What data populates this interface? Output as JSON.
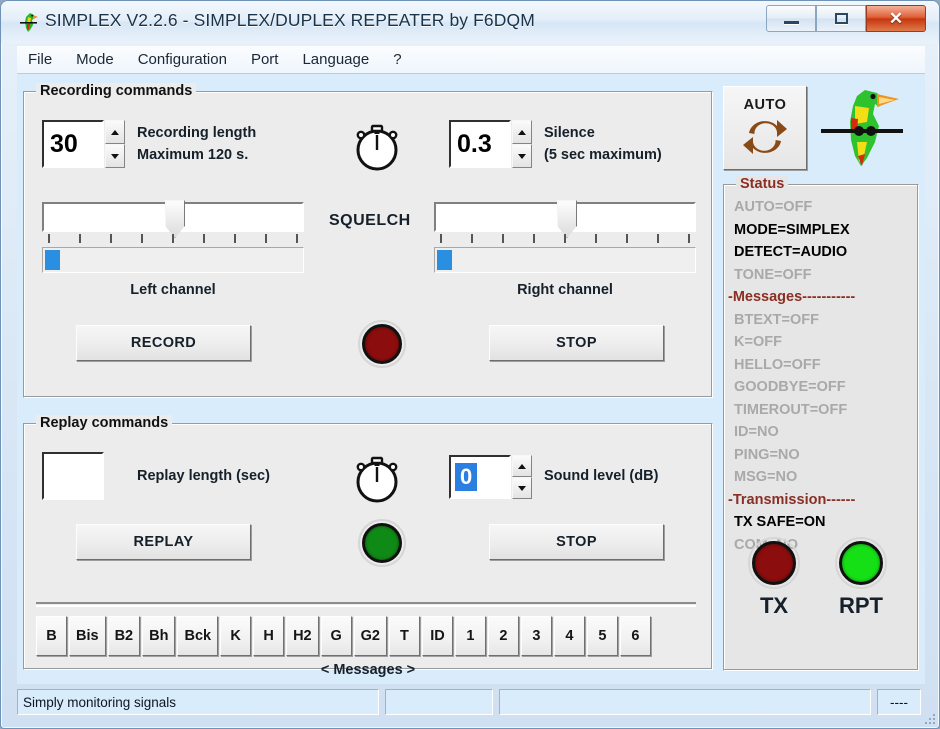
{
  "window": {
    "title": "SIMPLEX V2.2.6 - SIMPLEX/DUPLEX REPEATER by F6DQM",
    "icon": "parrot-icon",
    "minimize_label": "minimize-icon",
    "maximize_label": "maximize-icon",
    "close_label": "✕"
  },
  "menu": {
    "items": [
      {
        "label": "File"
      },
      {
        "label": "Mode"
      },
      {
        "label": "Configuration"
      },
      {
        "label": "Port"
      },
      {
        "label": "Language"
      },
      {
        "label": "?"
      }
    ]
  },
  "recording": {
    "group_title": "Recording commands",
    "length_value": "30",
    "length_label_line1": "Recording length",
    "length_label_line2": "Maximum 120 s.",
    "silence_value": "0.3",
    "silence_label_line1": "Silence",
    "silence_label_line2": "(5 sec maximum)",
    "squelch_label": "SQUELCH",
    "left_channel_label": "Left channel",
    "right_channel_label": "Right channel",
    "record_button": "RECORD",
    "stop_button": "STOP",
    "left_slider_percent": 50,
    "right_slider_percent": 50,
    "left_meter_percent": 6,
    "right_meter_percent": 6,
    "led_color": "#8c0d0d",
    "meter_color": "#2a8fe0"
  },
  "replay": {
    "group_title": "Replay commands",
    "length_value": "",
    "length_label": "Replay length (sec)",
    "sound_level_value": "0",
    "sound_level_label": "Sound level (dB)",
    "replay_button": "REPLAY",
    "stop_button": "STOP",
    "led_color": "#0f8a16",
    "messages_caption": "< Messages >",
    "message_buttons": [
      "B",
      "Bis",
      "B2",
      "Bh",
      "Bck",
      "K",
      "H",
      "H2",
      "G",
      "G2",
      "T",
      "ID",
      "1",
      "2",
      "3",
      "4",
      "5",
      "6"
    ]
  },
  "auto": {
    "label": "AUTO",
    "icon": "refresh-cycle-icon"
  },
  "status": {
    "group_title": "Status",
    "lines": [
      {
        "text": "AUTO=OFF",
        "state": "off"
      },
      {
        "text": "MODE=SIMPLEX",
        "state": "on"
      },
      {
        "text": "DETECT=AUDIO",
        "state": "on"
      },
      {
        "text": "TONE=OFF",
        "state": "off"
      },
      {
        "text": "-Messages-----------",
        "state": "header"
      },
      {
        "text": "BTEXT=OFF",
        "state": "off"
      },
      {
        "text": "K=OFF",
        "state": "off"
      },
      {
        "text": "HELLO=OFF",
        "state": "off"
      },
      {
        "text": "GOODBYE=OFF",
        "state": "off"
      },
      {
        "text": "TIMEROUT=OFF",
        "state": "off"
      },
      {
        "text": "ID=NO",
        "state": "off"
      },
      {
        "text": "PING=NO",
        "state": "off"
      },
      {
        "text": "MSG=NO",
        "state": "off"
      },
      {
        "text": "-Transmission------",
        "state": "header"
      },
      {
        "text": "TX SAFE=ON",
        "state": "on"
      },
      {
        "text": "COM=NO",
        "state": "off"
      }
    ],
    "tx_label": "TX",
    "rpt_label": "RPT",
    "tx_led_color": "#8c0d0d",
    "rpt_led_color": "#15e015",
    "header_color": "#8b2f25"
  },
  "statusbar": {
    "message": "Simply monitoring signals",
    "panel2": "",
    "panel3": "",
    "panel4": "----"
  }
}
